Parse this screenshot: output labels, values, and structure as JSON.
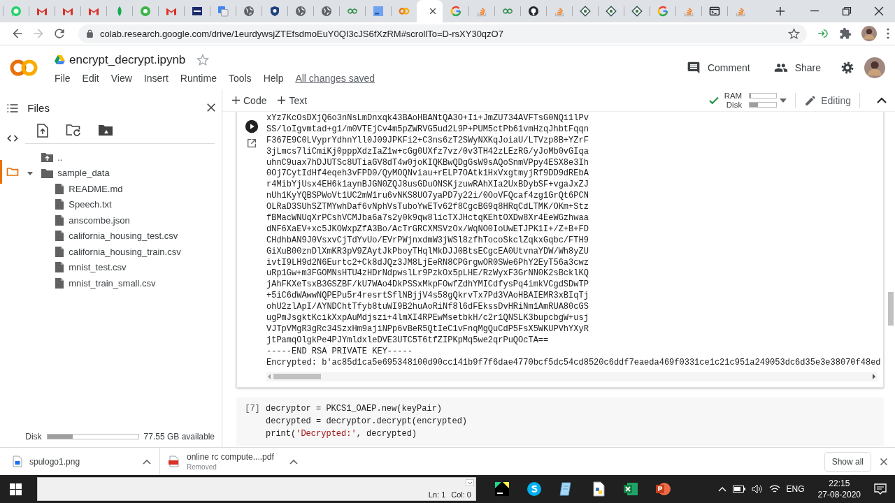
{
  "browser": {
    "tabs": [
      {
        "kind": "whatsapp",
        "selected": false
      },
      {
        "kind": "gmail",
        "selected": false
      },
      {
        "kind": "gmail",
        "selected": false
      },
      {
        "kind": "gmail",
        "selected": false
      },
      {
        "kind": "leaf",
        "selected": false
      },
      {
        "kind": "greenring",
        "selected": false
      },
      {
        "kind": "gmail",
        "selected": false
      },
      {
        "kind": "ieee",
        "selected": false
      },
      {
        "kind": "translate",
        "selected": false
      },
      {
        "kind": "globe",
        "selected": false
      },
      {
        "kind": "shield",
        "selected": false
      },
      {
        "kind": "globe",
        "selected": false
      },
      {
        "kind": "globe",
        "selected": false
      },
      {
        "kind": "geeks",
        "selected": false
      },
      {
        "kind": "pc",
        "selected": false
      },
      {
        "kind": "colab",
        "selected": false
      },
      {
        "kind": "blank",
        "selected": true
      },
      {
        "kind": "google",
        "selected": false
      },
      {
        "kind": "stack",
        "selected": false
      },
      {
        "kind": "geeks",
        "selected": false
      },
      {
        "kind": "github",
        "selected": false
      },
      {
        "kind": "stack",
        "selected": false
      },
      {
        "kind": "diamond",
        "selected": false
      },
      {
        "kind": "diamond",
        "selected": false
      },
      {
        "kind": "diamond",
        "selected": false
      },
      {
        "kind": "google",
        "selected": false
      },
      {
        "kind": "stack",
        "selected": false
      },
      {
        "kind": "terminal",
        "selected": false
      },
      {
        "kind": "stack",
        "selected": false
      }
    ],
    "url": "colab.research.google.com/drive/1eurdywsjZTEfsdmoEuY0QI3cJS6fXzRM#scrollTo=D-rsXY30qzO7"
  },
  "notebook": {
    "title": "encrypt_decrypt.ipynb",
    "menu": [
      "File",
      "Edit",
      "View",
      "Insert",
      "Runtime",
      "Tools",
      "Help"
    ],
    "save_status": "All changes saved",
    "actions": [
      {
        "kind": "comment",
        "label": "Comment"
      },
      {
        "kind": "share",
        "label": "Share"
      }
    ]
  },
  "toolbar": {
    "insert": [
      "Code",
      "Text"
    ],
    "resources": [
      {
        "label": "RAM",
        "level": 0.06
      },
      {
        "label": "Disk",
        "level": 0.3
      }
    ],
    "mode": "Editing"
  },
  "sidebar": {
    "rail": [
      {
        "kind": "toc",
        "selected": false
      },
      {
        "kind": "code",
        "selected": false
      },
      {
        "kind": "files",
        "selected": true
      }
    ],
    "title": "Files",
    "tree": [
      {
        "kind": "parent",
        "name": ".."
      },
      {
        "kind": "folder",
        "name": "sample_data",
        "expanded": true,
        "children": [
          {
            "kind": "file",
            "name": "README.md"
          },
          {
            "kind": "file",
            "name": "Speech.txt"
          },
          {
            "kind": "file",
            "name": "anscombe.json"
          },
          {
            "kind": "file",
            "name": "california_housing_test.csv"
          },
          {
            "kind": "file",
            "name": "california_housing_train.csv"
          },
          {
            "kind": "file",
            "name": "mnist_test.csv"
          },
          {
            "kind": "file",
            "name": "mnist_train_small.csv"
          }
        ]
      }
    ],
    "disk": {
      "label": "Disk",
      "level": 0.28,
      "reading": "77.55 GB available"
    }
  },
  "cells": [
    {
      "kind": "output",
      "lines": [
        "xYz7KcOsDXjQ6o3nNsLmDnxqk43BAoHBANtQA3O+Ii+JmZU734AVFTsG0NQi1lPv",
        "SS/loIgvmtad+g1/m0VTEjCv4m5pZWRVG5ud2L9P+PUM5ctPb61vmHzqJhbtFqqn",
        "F367E9C0LVyprYdhnYll0J09JPKFi2+C3ns6zT2SWyNXKqJoiaU/LTVzp8B+YZrF",
        "3jLmcs7liCmiKj0pppXdzIaZ1w+cGg0UXfz7vz/0v3TH42zLEzRG/yJoMb0vGIqa",
        "uhnC9uax7hDJUTSc8UTiaGV8dT4w0joKIQKBwQDgGsW9sAQoSnmVPpy4ESX8e3Ih",
        "0Oj7CytIdHf4eqeh3vFPD0/QyMOQNviau+rELP7OAtk1HxVxgtmyjRf9DD9dREbA",
        "r4MibYjUsx4EH6k1aynBJGN0ZQJ8usGDuONSKjzuwRAhXIa2UxBDybSF+vgaJxZJ",
        "nUh1KyYQBSPWoVt1UC2mW1ru6vNKS8UO7yaPD7y22i/0OoVFQcaf4zg1GrQt6PCN",
        "OLRaD3SUhSZTMYwhDaf6vNphVsTuboYwETv62f8CgcBG9q8HRqCdLTMK/OKm+Stz",
        "fBMacWNUqXrPCshVCMJba6a7s2y0k9qw8licTXJHctqKEhtOXDw8Xr4EeWGzhwaa",
        "dNF6XaEV+xc5JKOWxpZfA3Bo/AcTrGRCXMSVzOx/WqNO0IoUwETJPK1I+/Z+B+FD",
        "CHdhbAN9J0VsxvCjTdYvUo/EVrPWjnxdmW3jWSl8zfhTocoSkclZqkxGqbc/FTH9",
        "GiXuB00znDlXmKR3pV9ZAytJkPboyTHqlMkDJJ0BtsECgcEA0UtvnaYDW/Wh8yZU",
        "ivtI9LH9d2N6Eurtc2+Ck8dJQz3JM8LjEeRN8CPGrgwOR0SWe6PhY2EyT56a3cwz",
        "uRp1Gw+m3FGOMNsHTU4zHDrNdpwslLr9PzkOx5pLHE/RzWyxF3GrNN0K2sBcklKQ",
        "jAhFKXeTsxB3GSZBF/kU7WAo4DkPSSxMkpFOwfZdhYMICdfysPq4imkVCgdSDwTP",
        "+5iC6dWAwwNQPEPu5r4resrtSflNBjjV4s58gQkrvTx7Pd3VAoHBAIEMR3xBIqTj",
        "ohU2zlApI/AYNDChtTfyb8tuWI9B2huAoRiNf8l6dFEkssDvHRiNm1AmRUA80cGS",
        "ugPmJsgktKcikXxpAuMdjszi+4lmXI4RPEwMsetbkH/c2r1QNSLK3bupcbgW+usj",
        "VJTpVMgR3gRc34SzxHm9ajiNPp6vBeR5QtIeC1vFnqMgQuCdP5FsX5WKUPVhYXyR",
        "jtPamqOlgkPe4PJYmldxleDVE3UTC5T6tfZIPKpMq5we2qrPuQOcTA==",
        "-----END RSA PRIVATE KEY-----",
        "Encrypted: b'ac85d1ca5e695348100d90cc141b9f7f6dae4770bcf5dc54cd8520c6ddf7eaeda469f0331ce1c21c951a249053dc6d35e3e38070f48ed"
      ]
    },
    {
      "kind": "code",
      "prompt": "[7]",
      "lines": [
        [
          {
            "kind": "plain",
            "text": "decryptor = PKCS1_OAEP.new(keyPair)"
          }
        ],
        [
          {
            "kind": "plain",
            "text": "decrypted = decryptor.decrypt(encrypted)"
          }
        ],
        [
          {
            "kind": "plain",
            "text": "print("
          },
          {
            "kind": "string",
            "text": "'Decrypted:'"
          },
          {
            "kind": "plain",
            "text": ", decrypted)"
          }
        ]
      ]
    }
  ],
  "downloads": {
    "items": [
      {
        "kind": "image",
        "name": "spulogo1.png"
      },
      {
        "kind": "pdf",
        "name": "online rc compute....pdf",
        "status": "Removed"
      }
    ],
    "show_all": "Show all"
  },
  "taskbar": {
    "editor_status": [
      "Ln: 1",
      "Col: 0"
    ],
    "apps": [
      {
        "kind": "pycharm"
      },
      {
        "kind": "skype"
      },
      {
        "kind": "notepad"
      },
      {
        "kind": "python"
      },
      {
        "kind": "excel"
      },
      {
        "kind": "powerpoint"
      }
    ],
    "language": "ENG",
    "time": "22:15",
    "date": "27-08-2020"
  }
}
